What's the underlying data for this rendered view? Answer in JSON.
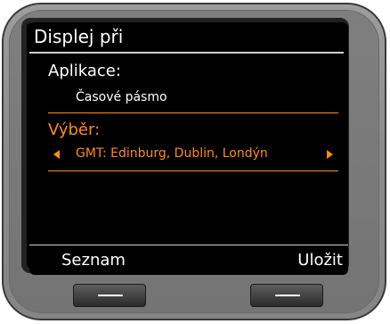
{
  "screen": {
    "title": "Displej při",
    "application": {
      "label": "Aplikace:",
      "value": "Časové pásmo"
    },
    "selection": {
      "label": "Výběr:",
      "value": "GMT: Edinburg, Dublin, Londýn"
    },
    "softkeys": {
      "left": "Seznam",
      "right": "Uložit"
    }
  },
  "colors": {
    "accent": "#ff8a1e",
    "screen_background": "#000000",
    "text": "#ffffff",
    "device_body": "#8c8c8c"
  },
  "icons": {
    "left_arrow": "chevron-left-icon",
    "right_arrow": "chevron-right-icon",
    "button_mark": "minus-icon"
  }
}
